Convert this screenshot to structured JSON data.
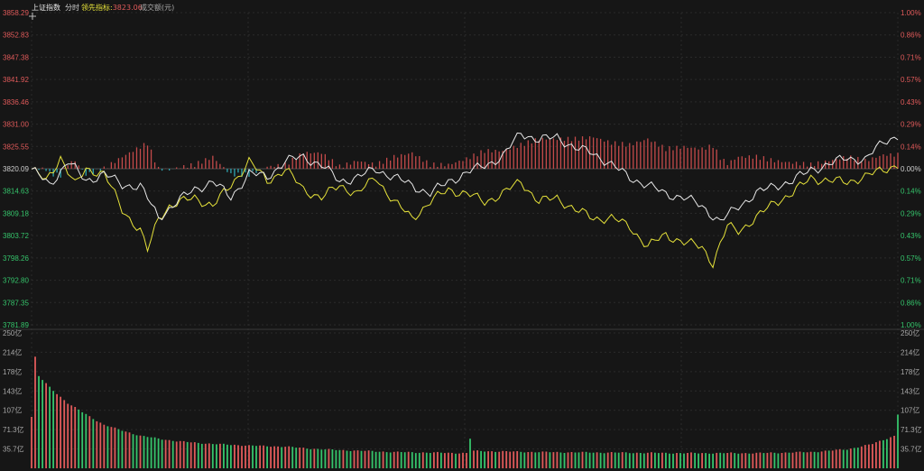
{
  "header": {
    "index_name": "上证指数",
    "mode": "分时",
    "lead_label": "领先指标:",
    "lead_value": "3823.06",
    "volume_label": "成交额(元)"
  },
  "colors": {
    "background": "#161616",
    "up_red": "#e05a5a",
    "down_green": "#35c46b",
    "price_line": "#e8e8e8",
    "lead_line": "#e6e23a",
    "diff_up": "#c44a4a",
    "diff_down": "#2fa6b2",
    "grid": "#2b2b2b"
  },
  "chart_data": {
    "type": "line",
    "price_axis": {
      "left_ticks": [
        "3858.29",
        "3852.83",
        "3847.38",
        "3841.92",
        "3836.46",
        "3831.00",
        "3825.55",
        "3820.09",
        "3814.63",
        "3809.18",
        "3803.72",
        "3798.26",
        "3792.80",
        "3787.35",
        "3781.89"
      ],
      "right_ticks": [
        "1.00%",
        "0.86%",
        "0.71%",
        "0.57%",
        "0.43%",
        "0.29%",
        "0.14%",
        "0.00%",
        "0.14%",
        "0.29%",
        "0.43%",
        "0.57%",
        "0.71%",
        "0.86%",
        "1.00%"
      ],
      "ylim": [
        3781.89,
        3858.29
      ],
      "baseline": 3820.09
    },
    "volume_axis": {
      "ticks": [
        "250亿",
        "214亿",
        "178亿",
        "143亿",
        "107亿",
        "71.3亿",
        "35.7亿"
      ],
      "ylim": [
        0,
        250
      ]
    },
    "x_points": 240,
    "price_keypoints": [
      [
        0,
        3820
      ],
      [
        5,
        3816
      ],
      [
        10,
        3822
      ],
      [
        15,
        3817
      ],
      [
        20,
        3819
      ],
      [
        25,
        3816
      ],
      [
        30,
        3816
      ],
      [
        35,
        3808
      ],
      [
        40,
        3812
      ],
      [
        45,
        3815
      ],
      [
        50,
        3817
      ],
      [
        55,
        3813
      ],
      [
        60,
        3819
      ],
      [
        65,
        3818
      ],
      [
        70,
        3822
      ],
      [
        75,
        3823
      ],
      [
        80,
        3821
      ],
      [
        85,
        3817
      ],
      [
        90,
        3818
      ],
      [
        95,
        3820
      ],
      [
        100,
        3818
      ],
      [
        105,
        3816
      ],
      [
        110,
        3814
      ],
      [
        115,
        3817
      ],
      [
        120,
        3819
      ],
      [
        125,
        3821
      ],
      [
        130,
        3823
      ],
      [
        135,
        3829
      ],
      [
        140,
        3827
      ],
      [
        145,
        3828
      ],
      [
        150,
        3825
      ],
      [
        155,
        3824
      ],
      [
        160,
        3821
      ],
      [
        165,
        3818
      ],
      [
        170,
        3816
      ],
      [
        175,
        3814
      ],
      [
        180,
        3813
      ],
      [
        185,
        3811
      ],
      [
        190,
        3807
      ],
      [
        195,
        3811
      ],
      [
        200,
        3814
      ],
      [
        205,
        3816
      ],
      [
        210,
        3817
      ],
      [
        215,
        3820
      ],
      [
        220,
        3821
      ],
      [
        225,
        3823
      ],
      [
        230,
        3822
      ],
      [
        235,
        3827
      ],
      [
        239,
        3828
      ]
    ],
    "lead_keypoints": [
      [
        0,
        3820
      ],
      [
        4,
        3817
      ],
      [
        8,
        3823
      ],
      [
        12,
        3816
      ],
      [
        15,
        3820
      ],
      [
        20,
        3819
      ],
      [
        25,
        3810
      ],
      [
        30,
        3805
      ],
      [
        32,
        3800
      ],
      [
        35,
        3808
      ],
      [
        38,
        3811
      ],
      [
        45,
        3813
      ],
      [
        50,
        3811
      ],
      [
        55,
        3816
      ],
      [
        60,
        3822
      ],
      [
        65,
        3817
      ],
      [
        70,
        3820
      ],
      [
        75,
        3815
      ],
      [
        80,
        3813
      ],
      [
        85,
        3816
      ],
      [
        90,
        3814
      ],
      [
        95,
        3818
      ],
      [
        100,
        3812
      ],
      [
        105,
        3808
      ],
      [
        110,
        3812
      ],
      [
        115,
        3815
      ],
      [
        120,
        3814
      ],
      [
        125,
        3812
      ],
      [
        130,
        3814
      ],
      [
        135,
        3817
      ],
      [
        140,
        3812
      ],
      [
        145,
        3813
      ],
      [
        150,
        3810
      ],
      [
        155,
        3808
      ],
      [
        160,
        3808
      ],
      [
        165,
        3806
      ],
      [
        170,
        3801
      ],
      [
        175,
        3804
      ],
      [
        180,
        3802
      ],
      [
        185,
        3801
      ],
      [
        188,
        3797
      ],
      [
        192,
        3806
      ],
      [
        195,
        3805
      ],
      [
        200,
        3808
      ],
      [
        205,
        3812
      ],
      [
        210,
        3814
      ],
      [
        215,
        3818
      ],
      [
        220,
        3817
      ],
      [
        225,
        3817
      ],
      [
        230,
        3818
      ],
      [
        235,
        3820
      ],
      [
        239,
        3821
      ]
    ],
    "volume_keypoints": [
      [
        0,
        95
      ],
      [
        1,
        205
      ],
      [
        2,
        170
      ],
      [
        5,
        150
      ],
      [
        10,
        120
      ],
      [
        15,
        100
      ],
      [
        20,
        80
      ],
      [
        30,
        60
      ],
      [
        40,
        50
      ],
      [
        50,
        45
      ],
      [
        60,
        42
      ],
      [
        70,
        40
      ],
      [
        80,
        35
      ],
      [
        100,
        30
      ],
      [
        120,
        28
      ],
      [
        121,
        55
      ],
      [
        122,
        32
      ],
      [
        140,
        30
      ],
      [
        160,
        29
      ],
      [
        180,
        28
      ],
      [
        200,
        28
      ],
      [
        215,
        30
      ],
      [
        225,
        35
      ],
      [
        232,
        45
      ],
      [
        238,
        60
      ],
      [
        239,
        100
      ]
    ]
  }
}
